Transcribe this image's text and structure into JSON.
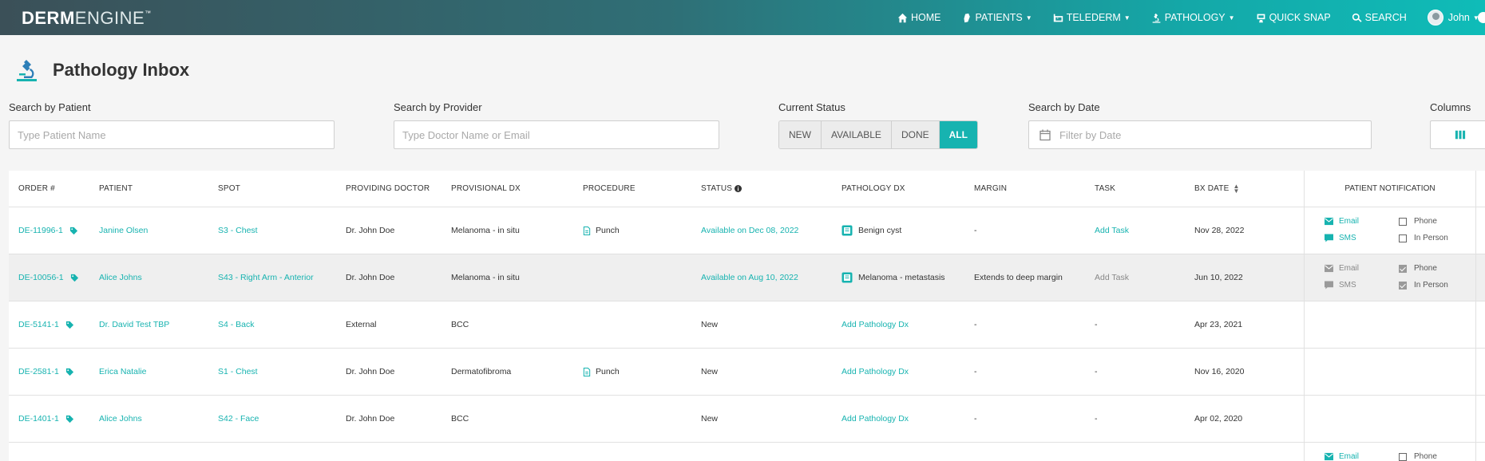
{
  "app": {
    "logo_bold": "DERM",
    "logo_thin": "ENGINE",
    "logo_tm": "™"
  },
  "nav": {
    "home": "HOME",
    "patients": "PATIENTS",
    "telederm": "TELEDERM",
    "pathology": "PATHOLOGY",
    "quick_snap": "QUICK SNAP",
    "search": "SEARCH",
    "user": "John"
  },
  "page": {
    "title": "Pathology Inbox"
  },
  "filters": {
    "patient_label": "Search by Patient",
    "patient_placeholder": "Type Patient Name",
    "provider_label": "Search by Provider",
    "provider_placeholder": "Type Doctor Name or Email",
    "status_label": "Current Status",
    "status_options": [
      "NEW",
      "AVAILABLE",
      "DONE",
      "ALL"
    ],
    "status_selected": "ALL",
    "date_label": "Search by Date",
    "date_placeholder": "Filter by Date",
    "columns_label": "Columns"
  },
  "table": {
    "headers": {
      "order": "ORDER #",
      "patient": "PATIENT",
      "spot": "SPOT",
      "doctor": "PROVIDING DOCTOR",
      "provisional": "PROVISIONAL DX",
      "procedure": "PROCEDURE",
      "status": "STATUS",
      "pathology": "PATHOLOGY DX",
      "margin": "MARGIN",
      "task": "TASK",
      "bxdate": "BX DATE",
      "notification": "PATIENT NOTIFICATION"
    },
    "notif_labels": {
      "email": "Email",
      "sms": "SMS",
      "phone": "Phone",
      "in_person": "In Person"
    },
    "rows": [
      {
        "order": "DE-11996-1",
        "patient": "Janine Olsen",
        "spot": "S3 - Chest",
        "doctor": "Dr. John Doe",
        "provisional": "Melanoma - in situ",
        "procedure": "Punch",
        "status": "Available on Dec 08, 2022",
        "pathology": "Benign cyst",
        "margin": "-",
        "task": "Add Task",
        "bxdate": "Nov 28, 2022"
      },
      {
        "order": "DE-10056-1",
        "patient": "Alice Johns",
        "spot": "S43 - Right Arm - Anterior",
        "doctor": "Dr. John Doe",
        "provisional": "Melanoma - in situ",
        "procedure": "",
        "status": "Available on Aug 10, 2022",
        "pathology": "Melanoma - metastasis",
        "margin": "Extends to deep margin",
        "task": "Add Task",
        "bxdate": "Jun 10, 2022"
      },
      {
        "order": "DE-5141-1",
        "patient": "Dr. David Test TBP",
        "spot": "S4 - Back",
        "doctor": "External",
        "provisional": "BCC",
        "procedure": "",
        "status": "New",
        "pathology": "Add Pathology Dx",
        "margin": "-",
        "task": "-",
        "bxdate": "Apr 23, 2021"
      },
      {
        "order": "DE-2581-1",
        "patient": "Erica Natalie",
        "spot": "S1 - Chest",
        "doctor": "Dr. John Doe",
        "provisional": "Dermatofibroma",
        "procedure": "Punch",
        "status": "New",
        "pathology": "Add Pathology Dx",
        "margin": "-",
        "task": "-",
        "bxdate": "Nov 16, 2020"
      },
      {
        "order": "DE-1401-1",
        "patient": "Alice Johns",
        "spot": "S42 - Face",
        "doctor": "Dr. John Doe",
        "provisional": "BCC",
        "procedure": "",
        "status": "New",
        "pathology": "Add Pathology Dx",
        "margin": "-",
        "task": "-",
        "bxdate": "Apr 02, 2020"
      }
    ]
  },
  "colors": {
    "accent": "#17b3b0",
    "nav_start": "#3b5058",
    "nav_end": "#0fbcb8"
  }
}
